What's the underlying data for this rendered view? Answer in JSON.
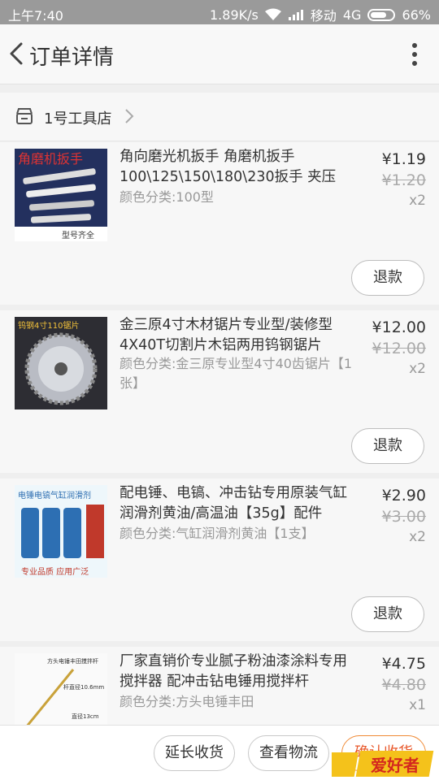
{
  "status_bar": {
    "time": "上午7:40",
    "speed": "1.89K/s",
    "carrier": "移动",
    "network": "4G",
    "battery": "66%"
  },
  "header": {
    "title": "订单详情",
    "back_icon": "chevron-left-icon",
    "more_icon": "vertical-dots-icon"
  },
  "shop": {
    "name": "1号工具店"
  },
  "items": [
    {
      "title": "角向磨光机扳手 角磨机扳手 100\\125\\150\\180\\230扳手 夹压板...",
      "spec": "颜色分类:100型",
      "price": "¥1.19",
      "original_price": "¥1.20",
      "qty": "x2",
      "refund_label": "退款",
      "thumb_text": "角磨机扳手",
      "thumb_caption": "型号齐全"
    },
    {
      "title": "金三原4寸木材锯片专业型/装修型 4X40T切割片木铝两用钨钢锯片",
      "spec": "颜色分类:金三原专业型4寸40齿锯片【1张】",
      "price": "¥12.00",
      "original_price": "¥12.00",
      "qty": "x2",
      "refund_label": "退款",
      "thumb_text": "钨钢4寸110锯片"
    },
    {
      "title": "配电锤、电镐、冲击钻专用原装气缸润滑剂黄油/高温油【35g】配件",
      "spec": "颜色分类:气缸润滑剂黄油【1支】",
      "price": "¥2.90",
      "original_price": "¥3.00",
      "qty": "x2",
      "refund_label": "退款",
      "thumb_text": "电锤电镐气缸润滑剂",
      "thumb_caption": "专业品质 应用广泛"
    },
    {
      "title": "厂家直销价专业腻子粉油漆涂料专用搅拌器 配冲击钻电锤用搅拌杆",
      "spec": "颜色分类:方头电锤丰田",
      "price": "¥4.75",
      "original_price": "¥4.80",
      "qty": "x1",
      "thumb_text": "方头电锤丰田搅拌杆",
      "thumb_label_1": "杆直径10.6mm",
      "thumb_label_2": "直径13cm"
    }
  ],
  "bottom_bar": {
    "extend_label": "延长收货",
    "track_label": "查看物流",
    "confirm_label": "确认收货"
  },
  "watermark": {
    "text": "爱好者"
  },
  "colors": {
    "accent": "#e8572a",
    "status_bar": "#9a9a9a",
    "background": "#efefef"
  }
}
